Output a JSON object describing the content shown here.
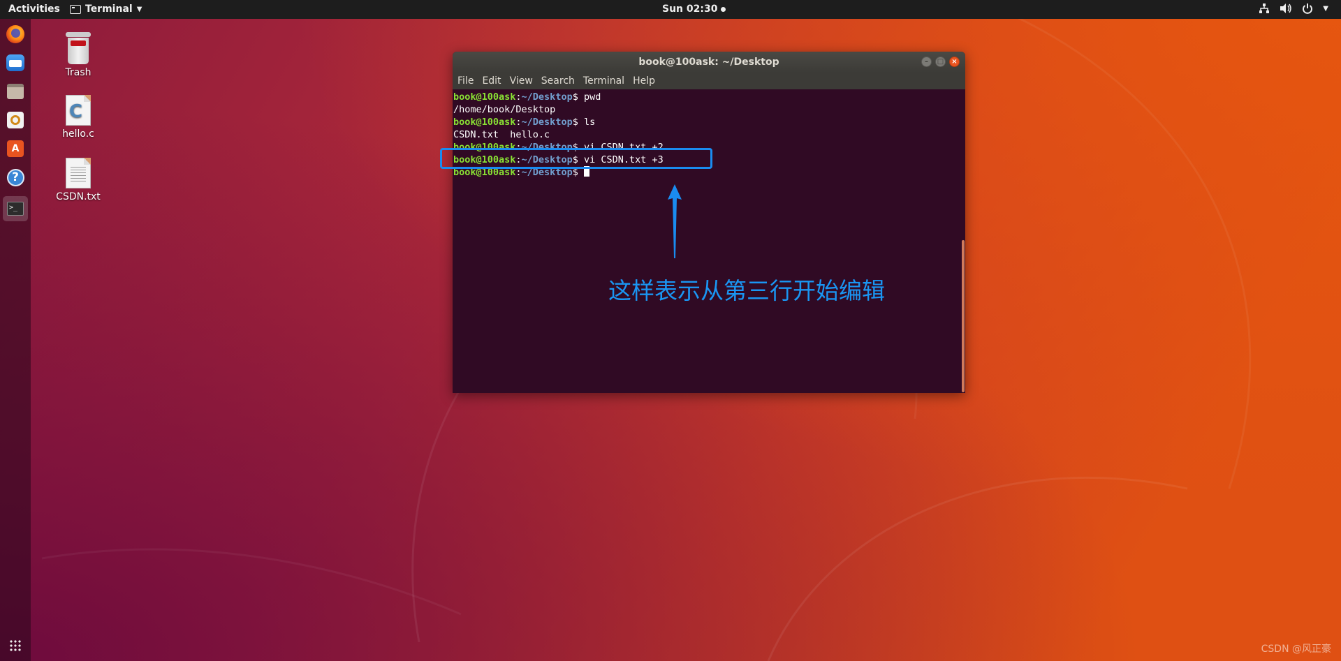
{
  "topbar": {
    "activities": "Activities",
    "app_name": "Terminal",
    "clock": "Sun 02:30"
  },
  "dock": {
    "items": [
      "firefox",
      "thunderbird",
      "files",
      "rhythmbox",
      "software",
      "help",
      "terminal"
    ]
  },
  "desktop": {
    "icons": [
      {
        "label": "Trash"
      },
      {
        "label": "hello.c"
      },
      {
        "label": "CSDN.txt"
      }
    ]
  },
  "terminal": {
    "title": "book@100ask: ~/Desktop",
    "menu": [
      "File",
      "Edit",
      "View",
      "Search",
      "Terminal",
      "Help"
    ],
    "prompt_user": "book@100ask",
    "prompt_path": "~/Desktop",
    "lines": [
      {
        "type": "cmd",
        "text": " pwd"
      },
      {
        "type": "out",
        "text": "/home/book/Desktop"
      },
      {
        "type": "cmd",
        "text": " ls"
      },
      {
        "type": "out",
        "text": "CSDN.txt  hello.c"
      },
      {
        "type": "cmd",
        "text": " vi CSDN.txt +2"
      },
      {
        "type": "cmd",
        "text": " vi CSDN.txt +3"
      },
      {
        "type": "cmd",
        "text": " "
      }
    ]
  },
  "annotation": {
    "text": "这样表示从第三行开始编辑",
    "color": "#1a8cf0"
  },
  "watermark": "CSDN @风正豪"
}
